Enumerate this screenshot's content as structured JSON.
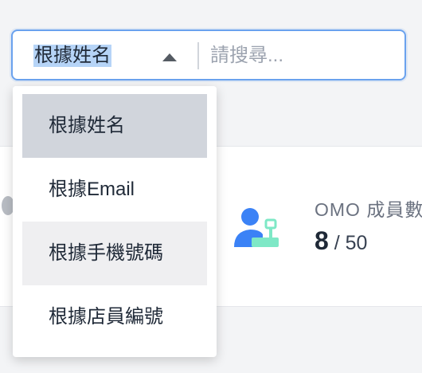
{
  "search": {
    "selected_field": "根據姓名",
    "placeholder": "請搜尋..."
  },
  "dropdown": {
    "options": [
      {
        "label": "根據姓名",
        "state": "selected"
      },
      {
        "label": "根據Email",
        "state": "normal"
      },
      {
        "label": "根據手機號碼",
        "state": "hover"
      },
      {
        "label": "根據店員編號",
        "state": "normal"
      }
    ]
  },
  "stat": {
    "label": "OMO 成員數",
    "value": "8",
    "separator": " / ",
    "total": "50",
    "icon": "user-register-icon"
  },
  "colors": {
    "focus_border": "#6aa2ee",
    "selection_highlight": "#b6d4f7",
    "icon_blue": "#3b82f6",
    "icon_green": "#7ee8c6"
  }
}
